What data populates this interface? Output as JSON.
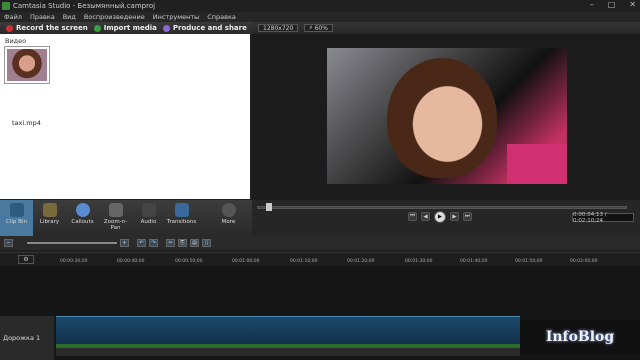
{
  "window": {
    "title": "Camtasia Studio - Безымянный.camproj"
  },
  "menu": [
    "Файл",
    "Правка",
    "Вид",
    "Воспроизведение",
    "Инструменты",
    "Справка"
  ],
  "toolbar": {
    "record": "Record the screen",
    "import": "Import media",
    "produce": "Produce and share"
  },
  "clip_bin": {
    "section_label": "Видео",
    "file_name": "taxi.mp4"
  },
  "preview": {
    "resolution": "1280x720",
    "zoom": "60%"
  },
  "tabs": [
    {
      "label": "Clip Bin",
      "icon": "film-icon"
    },
    {
      "label": "Library",
      "icon": "library-icon"
    },
    {
      "label": "Callouts",
      "icon": "callout-icon"
    },
    {
      "label": "Zoom-n-Pan",
      "icon": "zoom-icon"
    },
    {
      "label": "Audio",
      "icon": "audio-icon"
    },
    {
      "label": "Transitions",
      "icon": "transitions-icon"
    },
    {
      "label": "More",
      "icon": "more-icon"
    }
  ],
  "playback": {
    "timecode": "0:00:04;13 / 0:02:10;24",
    "progress": 0.035
  },
  "timeline": {
    "ticks": [
      "00:00:30;00",
      "00:00:40;00",
      "00:00:50;00",
      "00:01:00;00",
      "00:01:10;00",
      "00:01:20;00",
      "00:01:30;00",
      "00:01:40;00",
      "00:01:50;00",
      "00:02:00;00"
    ],
    "track_label": "Дорожка 1"
  },
  "watermark": "InfoBlog",
  "colors": {
    "accent": "#4a7aa0",
    "clip": "#1c4a6a",
    "record_dot": "#d03030",
    "produce_dot": "#8a6ad0",
    "import_dot": "#3aa040"
  }
}
